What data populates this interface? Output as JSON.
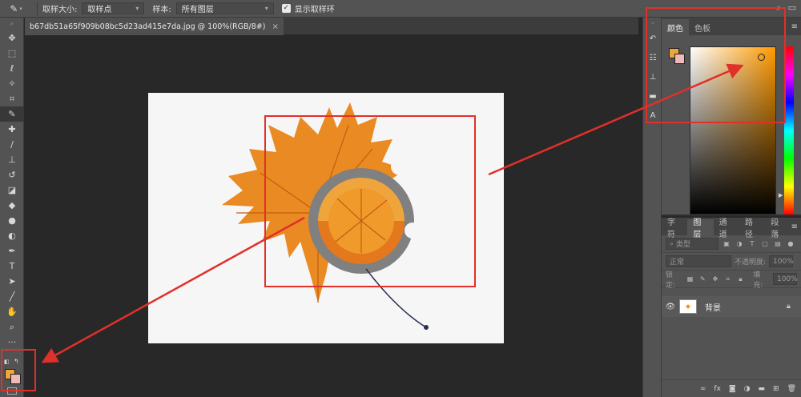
{
  "options_bar": {
    "tool_icon": "eyedropper-icon",
    "sample_size_label": "取样大小:",
    "sample_size_value": "取样点",
    "sample_label": "样本:",
    "sample_value": "所有图层",
    "show_ring_label": "显示取样环",
    "show_ring_checked": true
  },
  "document": {
    "tab_title": "b67db51a65f909b08bc5d23ad415e7da.jpg @ 100%(RGB/8#)",
    "close": "×"
  },
  "tools": [
    "move-icon",
    "marquee-icon",
    "lasso-icon",
    "quick-select-icon",
    "crop-icon",
    "eyedropper-icon",
    "healing-brush-icon",
    "brush-icon",
    "clone-stamp-icon",
    "history-brush-icon",
    "eraser-icon",
    "paint-bucket-icon",
    "blur-icon",
    "dodge-icon",
    "pen-icon",
    "type-icon",
    "path-select-icon",
    "line-icon",
    "hand-icon",
    "zoom-icon",
    "more-tools-icon"
  ],
  "active_tool": "eyedropper-icon",
  "foreground_color": "#f0a43c",
  "background_color": "#f1b8b8",
  "color_panel": {
    "tabs": [
      "颜色",
      "色板"
    ],
    "active_tab": "颜色"
  },
  "layers_panel": {
    "tabs": [
      "字符",
      "图层",
      "通道",
      "路径",
      "段落"
    ],
    "active_tab": "图层",
    "search_placeholder": "类型",
    "blend_mode": "正常",
    "opacity_label": "不透明度:",
    "opacity_value": "100%",
    "lock_label": "锁定:",
    "fill_label": "填充:",
    "fill_value": "100%",
    "layers": [
      {
        "name": "背景",
        "visible": true,
        "locked": true
      }
    ]
  },
  "annotation_color": "#e0302a"
}
